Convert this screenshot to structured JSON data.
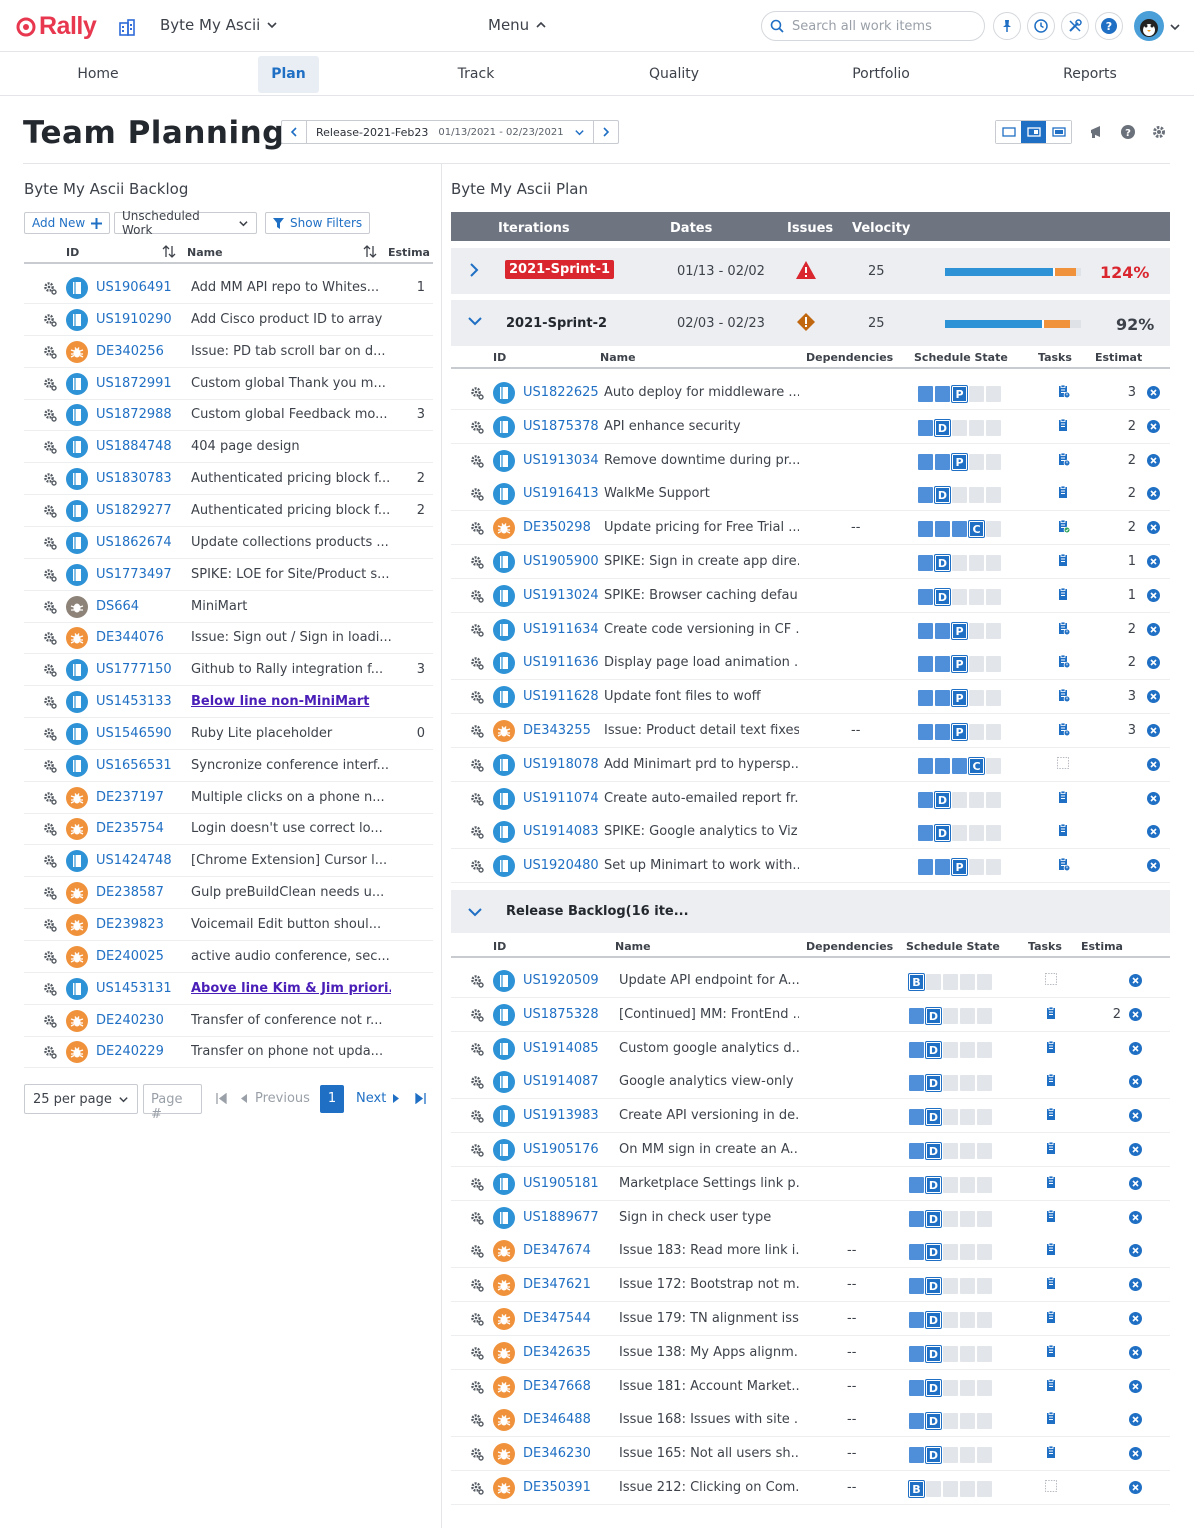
{
  "app": {
    "logo": "Rally",
    "workspace": "Byte My Ascii",
    "menu_label": "Menu",
    "search_placeholder": "Search all work items"
  },
  "nav": {
    "tabs": [
      "Home",
      "Plan",
      "Track",
      "Quality",
      "Portfolio",
      "Reports"
    ],
    "active": "Plan"
  },
  "page": {
    "title": "Team Planning",
    "release_name": "Release-2021-Feb23",
    "release_dates": "01/13/2021 - 02/23/2021"
  },
  "backlog": {
    "title": "Byte My Ascii Backlog",
    "add_new": "Add New",
    "filter": "Unscheduled Work",
    "show_filters": "Show Filters",
    "columns": {
      "id": "ID",
      "name": "Name",
      "estimate": "Estima"
    },
    "rows": [
      {
        "type": "story",
        "id": "US1906491",
        "name": "Add MM API repo to Whites...",
        "est": "1"
      },
      {
        "type": "story",
        "id": "US1910290",
        "name": "Add Cisco product ID to array",
        "est": ""
      },
      {
        "type": "defect",
        "id": "DE340256",
        "name": "Issue: PD tab scroll bar on d...",
        "est": ""
      },
      {
        "type": "story",
        "id": "US1872991",
        "name": "Custom global Thank you m...",
        "est": ""
      },
      {
        "type": "story",
        "id": "US1872988",
        "name": "Custom global Feedback mo...",
        "est": "3"
      },
      {
        "type": "story",
        "id": "US1884748",
        "name": "404 page design",
        "est": ""
      },
      {
        "type": "story",
        "id": "US1830783",
        "name": "Authenticated pricing block f...",
        "est": "2"
      },
      {
        "type": "story",
        "id": "US1829277",
        "name": "Authenticated pricing block f...",
        "est": "2"
      },
      {
        "type": "story",
        "id": "US1862674",
        "name": "Update collections products ...",
        "est": ""
      },
      {
        "type": "story",
        "id": "US1773497",
        "name": "SPIKE: LOE for Site/Product s...",
        "est": ""
      },
      {
        "type": "ds",
        "id": "DS664",
        "name": "MiniMart",
        "est": ""
      },
      {
        "type": "defect",
        "id": "DE344076",
        "name": "Issue: Sign out / Sign in loadi...",
        "est": ""
      },
      {
        "type": "story",
        "id": "US1777150",
        "name": "Github to Rally integration f...",
        "est": "3"
      },
      {
        "type": "story",
        "id": "US1453133",
        "name": "Below line non-MiniMart",
        "est": "",
        "sep": true
      },
      {
        "type": "story",
        "id": "US1546590",
        "name": "Ruby Lite placeholder",
        "est": "0"
      },
      {
        "type": "story",
        "id": "US1656531",
        "name": "Syncronize conference interf...",
        "est": ""
      },
      {
        "type": "defect",
        "id": "DE237197",
        "name": "Multiple clicks on a phone n...",
        "est": ""
      },
      {
        "type": "defect",
        "id": "DE235754",
        "name": "Login doesn't use correct lo...",
        "est": ""
      },
      {
        "type": "story",
        "id": "US1424748",
        "name": "[Chrome Extension] Cursor l...",
        "est": ""
      },
      {
        "type": "defect",
        "id": "DE238587",
        "name": "Gulp preBuildClean needs u...",
        "est": ""
      },
      {
        "type": "defect",
        "id": "DE239823",
        "name": "Voicemail Edit button shoul...",
        "est": ""
      },
      {
        "type": "defect",
        "id": "DE240025",
        "name": "active audio conference, sec...",
        "est": ""
      },
      {
        "type": "story",
        "id": "US1453131",
        "name": "Above line Kim & Jim priori...",
        "est": "",
        "sep": true
      },
      {
        "type": "defect",
        "id": "DE240230",
        "name": "Transfer of conference not r...",
        "est": ""
      },
      {
        "type": "defect",
        "id": "DE240229",
        "name": "Transfer on phone not upda...",
        "est": ""
      }
    ],
    "pager": {
      "per_page": "25 per page",
      "page_placeholder": "Page #",
      "previous": "Previous",
      "next": "Next",
      "current": "1"
    }
  },
  "plan": {
    "title": "Byte My Ascii Plan",
    "columns": {
      "iterations": "Iterations",
      "dates": "Dates",
      "issues": "Issues",
      "velocity": "Velocity"
    },
    "row_columns": {
      "id": "ID",
      "name": "Name",
      "dependencies": "Dependencies",
      "schedule_state": "Schedule State",
      "tasks": "Tasks",
      "estimate": "Estimat",
      "estimate_rb": "Estima"
    },
    "sprint1": {
      "name": "2021-Sprint-1",
      "dates": "01/13 - 02/02",
      "velocity": "25",
      "percent": "124%",
      "fill": 0.81,
      "over": 0.15,
      "pct_color": "#d9262f"
    },
    "sprint2": {
      "name": "2021-Sprint-2",
      "dates": "02/03 - 02/23",
      "velocity": "25",
      "percent": "92%",
      "fill": 0.73,
      "over": 0.19,
      "pct_color": "#3d424a"
    },
    "sprint2_rows": [
      {
        "type": "story",
        "id": "US1822625",
        "name": "Auto deploy for middleware ...",
        "dep": "",
        "state": "P",
        "task": "task-warn",
        "est": "3"
      },
      {
        "type": "story",
        "id": "US1875378",
        "name": "API enhance security",
        "dep": "",
        "state": "D",
        "task": "task",
        "est": "2"
      },
      {
        "type": "story",
        "id": "US1913034",
        "name": "Remove downtime during pr...",
        "dep": "",
        "state": "P",
        "task": "task-warn",
        "est": "2"
      },
      {
        "type": "story",
        "id": "US1916413",
        "name": "WalkMe Support",
        "dep": "",
        "state": "D",
        "task": "task",
        "est": "2"
      },
      {
        "type": "defect",
        "id": "DE350298",
        "name": "Update pricing for Free Trial ...",
        "dep": "--",
        "state": "C",
        "task": "task-ok",
        "est": "2"
      },
      {
        "type": "story",
        "id": "US1905900",
        "name": "SPIKE: Sign in create app dire...",
        "dep": "",
        "state": "D",
        "task": "task",
        "est": "1"
      },
      {
        "type": "story",
        "id": "US1913024",
        "name": "SPIKE: Browser caching defau...",
        "dep": "",
        "state": "D",
        "task": "task",
        "est": "1"
      },
      {
        "type": "story",
        "id": "US1911634",
        "name": "Create code versioning in CF ...",
        "dep": "",
        "state": "P",
        "task": "task-warn",
        "est": "2"
      },
      {
        "type": "story",
        "id": "US1911636",
        "name": "Display page load animation ...",
        "dep": "",
        "state": "P",
        "task": "task-warn",
        "est": "2"
      },
      {
        "type": "story",
        "id": "US1911628",
        "name": "Update font files to woff",
        "dep": "",
        "state": "P",
        "task": "task-warn",
        "est": "3"
      },
      {
        "type": "defect",
        "id": "DE343255",
        "name": "Issue: Product detail text fixes",
        "dep": "--",
        "state": "P",
        "task": "task-warn",
        "est": "3"
      },
      {
        "type": "story",
        "id": "US1918078",
        "name": "Add Minimart prd to hypersp...",
        "dep": "",
        "state": "C",
        "task": "none",
        "est": ""
      },
      {
        "type": "story",
        "id": "US1911074",
        "name": "Create auto-emailed report fr...",
        "dep": "",
        "state": "D",
        "task": "task",
        "est": ""
      },
      {
        "type": "story",
        "id": "US1914083",
        "name": "SPIKE: Google analytics to Viz...",
        "dep": "",
        "state": "D",
        "task": "task",
        "est": ""
      },
      {
        "type": "story",
        "id": "US1920480",
        "name": "Set up Minimart to work with...",
        "dep": "",
        "state": "P",
        "task": "task-warn",
        "est": ""
      }
    ],
    "release_backlog": {
      "name": "Release Backlog(16 ite..."
    },
    "backlog_rows": [
      {
        "type": "story",
        "id": "US1920509",
        "name": "Update API endpoint for A...",
        "dep": "",
        "state": "B",
        "task": "none",
        "est": ""
      },
      {
        "type": "story",
        "id": "US1875328",
        "name": "[Continued] MM: FrontEnd ...",
        "dep": "",
        "state": "D",
        "task": "task",
        "est": "2"
      },
      {
        "type": "story",
        "id": "US1914085",
        "name": "Custom google analytics d...",
        "dep": "",
        "state": "D",
        "task": "task",
        "est": ""
      },
      {
        "type": "story",
        "id": "US1914087",
        "name": "Google analytics view-only ...",
        "dep": "",
        "state": "D",
        "task": "task",
        "est": ""
      },
      {
        "type": "story",
        "id": "US1913983",
        "name": "Create API versioning in de...",
        "dep": "",
        "state": "D",
        "task": "task",
        "est": ""
      },
      {
        "type": "story",
        "id": "US1905176",
        "name": "On MM sign in create an A...",
        "dep": "",
        "state": "D",
        "task": "task",
        "est": ""
      },
      {
        "type": "story",
        "id": "US1905181",
        "name": "Marketplace Settings link p...",
        "dep": "",
        "state": "D",
        "task": "task",
        "est": ""
      },
      {
        "type": "story",
        "id": "US1889677",
        "name": "Sign in check user type",
        "dep": "",
        "state": "D",
        "task": "task",
        "est": ""
      },
      {
        "type": "defect",
        "id": "DE347674",
        "name": "Issue 183: Read more link i...",
        "dep": "--",
        "state": "D",
        "task": "task",
        "est": ""
      },
      {
        "type": "defect",
        "id": "DE347621",
        "name": "Issue 172: Bootstrap not m...",
        "dep": "--",
        "state": "D",
        "task": "task",
        "est": ""
      },
      {
        "type": "defect",
        "id": "DE347544",
        "name": "Issue 179: TN alignment iss...",
        "dep": "--",
        "state": "D",
        "task": "task",
        "est": ""
      },
      {
        "type": "defect",
        "id": "DE342635",
        "name": "Issue 138: My Apps alignm...",
        "dep": "--",
        "state": "D",
        "task": "task",
        "est": ""
      },
      {
        "type": "defect",
        "id": "DE347668",
        "name": "Issue 181: Account Market...",
        "dep": "--",
        "state": "D",
        "task": "task",
        "est": ""
      },
      {
        "type": "defect",
        "id": "DE346488",
        "name": "Issue 168: Issues with site ...",
        "dep": "--",
        "state": "D",
        "task": "task",
        "est": ""
      },
      {
        "type": "defect",
        "id": "DE346230",
        "name": "Issue 165: Not all users sh...",
        "dep": "--",
        "state": "D",
        "task": "task",
        "est": ""
      },
      {
        "type": "defect",
        "id": "DE350391",
        "name": "Issue 212: Clicking on Com...",
        "dep": "--",
        "state": "B",
        "task": "none",
        "est": ""
      }
    ]
  },
  "colors": {
    "accent": "#1f6fc4",
    "story": "#2e92d6",
    "defect": "#f0923c",
    "ds": "#8d8378",
    "danger": "#d9262f"
  }
}
